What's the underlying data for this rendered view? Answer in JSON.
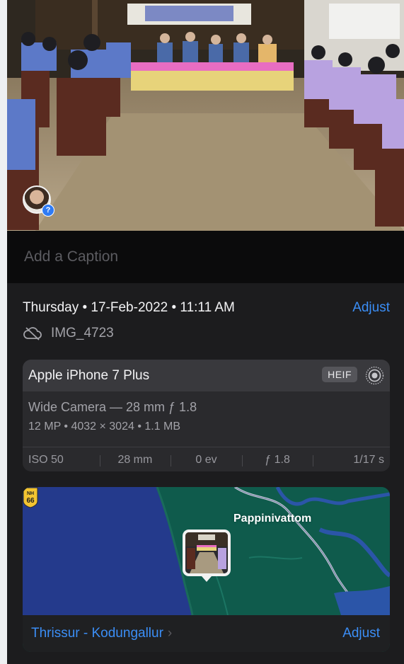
{
  "caption": {
    "placeholder": "Add a Caption",
    "value": ""
  },
  "info": {
    "datetime": "Thursday • 17-Feb-2022 • 11:11 AM",
    "adjust_label": "Adjust",
    "cloud_icon": "cloud-off-icon",
    "filename": "IMG_4723"
  },
  "camera": {
    "device": "Apple iPhone 7 Plus",
    "format_badge": "HEIF",
    "live_icon": "live-photo-icon",
    "lens": "Wide Camera — 28 mm ƒ 1.8",
    "specs": "12 MP  •  4032 × 3024  •  1.1 MB",
    "exif": [
      "ISO 50",
      "28 mm",
      "0 ev",
      "ƒ 1.8",
      "1/17 s"
    ]
  },
  "map": {
    "place_label": "Pappinivattom",
    "highway_top": "NH",
    "highway_num": "66",
    "location": "Thrissur - Kodungallur",
    "adjust_label": "Adjust"
  },
  "colors": {
    "accent": "#3b8ef6",
    "background": "#1c1c1e",
    "sea": "#243a8c",
    "land": "#0f5b4c"
  }
}
